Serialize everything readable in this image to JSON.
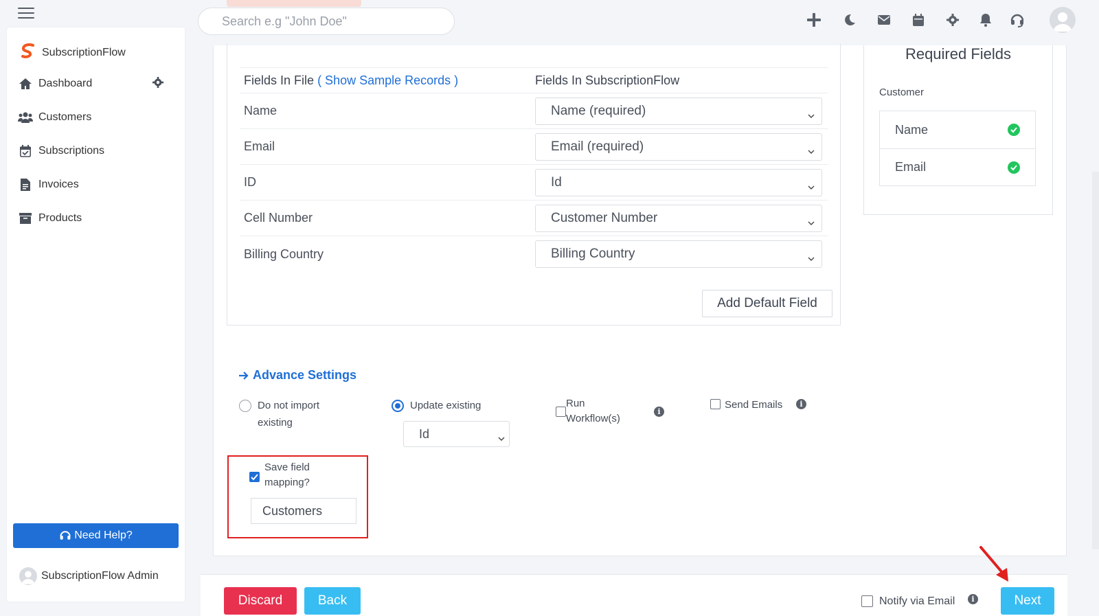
{
  "topbar": {
    "search_placeholder": "Search e.g \"John Doe\"",
    "icons": [
      "plus-icon",
      "moon-icon",
      "mail-icon",
      "calendar-icon",
      "gear-icon",
      "bell-icon",
      "headset-icon",
      "avatar"
    ]
  },
  "sidebar": {
    "brand": "SubscriptionFlow",
    "items": [
      {
        "label": "Dashboard",
        "icon": "home-icon"
      },
      {
        "label": "Customers",
        "icon": "users-icon"
      },
      {
        "label": "Subscriptions",
        "icon": "calendar-check-icon"
      },
      {
        "label": "Invoices",
        "icon": "invoice-icon"
      },
      {
        "label": "Products",
        "icon": "archive-icon"
      }
    ],
    "help_label": "Need Help?",
    "admin_name": "SubscriptionFlow Admin"
  },
  "mapping": {
    "header_file": "Fields In File",
    "header_link": "( Show Sample Records )",
    "header_sf": "Fields In SubscriptionFlow",
    "rows": [
      {
        "file_field": "Name",
        "sf_field": "Name (required)"
      },
      {
        "file_field": "Email",
        "sf_field": "Email (required)"
      },
      {
        "file_field": "ID",
        "sf_field": "Id"
      },
      {
        "file_field": "Cell Number",
        "sf_field": "Customer Number"
      },
      {
        "file_field": "Billing Country",
        "sf_field": "Billing Country"
      }
    ],
    "add_default_label": "Add Default Field"
  },
  "advance": {
    "title": "Advance Settings",
    "do_not_import_line1": "Do not import",
    "do_not_import_line2": "existing",
    "update_existing": "Update existing",
    "update_key": "Id",
    "run_workflow_line1": "Run",
    "run_workflow_line2": "Workflow(s)",
    "send_emails": "Send Emails",
    "save_mapping_line1": "Save field",
    "save_mapping_line2": "mapping?",
    "save_mapping_checked": true,
    "mapping_name": "Customers"
  },
  "required": {
    "title": "Required Fields",
    "module": "Customer",
    "fields": [
      "Name",
      "Email"
    ],
    "ok_color": "#22c55e"
  },
  "footer": {
    "discard": "Discard",
    "back": "Back",
    "notify": "Notify via Email",
    "next": "Next"
  },
  "colors": {
    "primary": "#1f6fd6",
    "danger": "#e8314f",
    "info": "#38bdf2",
    "highlight": "#e02020"
  }
}
